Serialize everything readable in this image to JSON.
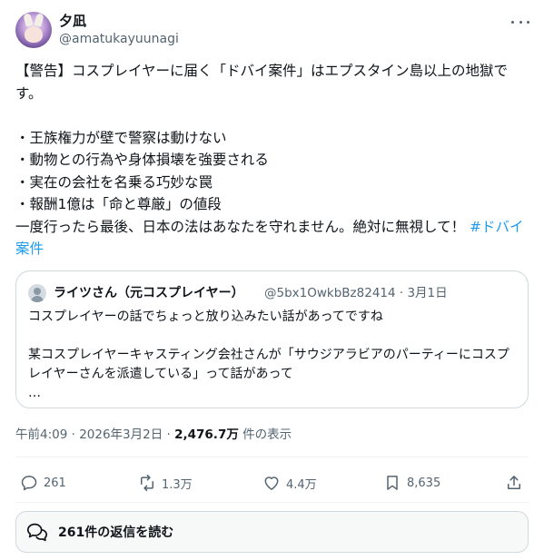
{
  "author": {
    "display_name": "夕凪",
    "handle": "@amatukayuunagi"
  },
  "tweet": {
    "text_main": "【警告】コスプレイヤーに届く「ドバイ案件」はエプスタイン島以上の地獄です。\n\n・王族権力が壁で警察は動けない\n・動物との行為や身体損壊を強要される\n・実在の会社を名乗る巧妙な罠\n・報酬1億は「命と尊厳」の値段\n一度行ったら最後、日本の法はあなたを守れません。絶対に無視して！ ",
    "hashtag": "#ドバイ案件"
  },
  "quoted_tweet": {
    "display_name": "ライツさん（元コスプレイヤー）",
    "meta": "@5bx1OwkbBz82414 · 3月1日",
    "text": "コスプレイヤーの話でちょっと放り込みたい話があってですね\n\n某コスプレイヤーキャスティング会社さんが「サウジアラビアのパーティーにコスプレイヤーさんを派遣している」って話があって\n…"
  },
  "meta": {
    "timestamp": "午前4:09 · 2026年3月2日 · ",
    "views_count": "2,476.7万",
    "views_label": " 件の表示"
  },
  "actions": {
    "reply_count": "261",
    "retweet_count": "1.3万",
    "like_count": "4.4万",
    "bookmark_count": "8,635"
  },
  "replies_button": {
    "label": "261件の返信を読む"
  },
  "icons": {
    "more": "more-horizontal-icon",
    "reply": "reply-icon",
    "retweet": "retweet-icon",
    "like": "heart-icon",
    "bookmark": "bookmark-icon",
    "share": "share-icon",
    "replies": "speech-bubbles-icon"
  },
  "colors": {
    "text_primary": "#0f1419",
    "text_secondary": "#536471",
    "link": "#1d9bf0",
    "border": "#cfd9de"
  }
}
